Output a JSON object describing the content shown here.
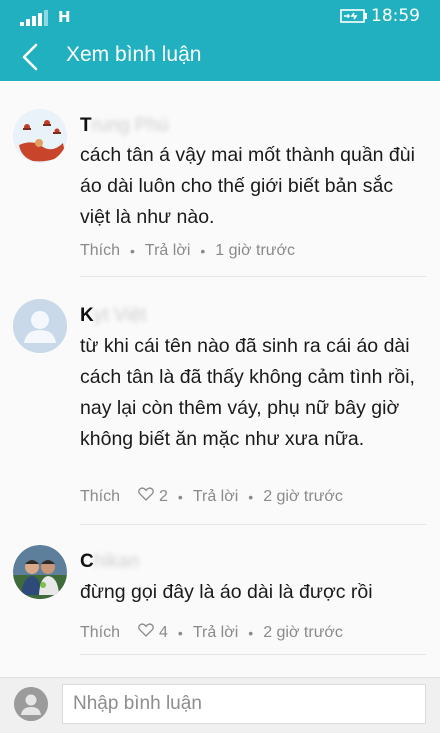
{
  "status_bar": {
    "network": "H",
    "time": "18:59"
  },
  "app_bar": {
    "title": "Xem bình luận"
  },
  "comments": [
    {
      "author_visible": "T",
      "author_obscured": "rung Phú",
      "text": "cách tân á vậy mai mốt thành quần đùi áo dài luôn cho thế giới biết bản sắc việt là như nào.",
      "like_label": "Thích",
      "likes": "",
      "reply_label": "Trả lời",
      "time": "1 giờ trước"
    },
    {
      "author_visible": "K",
      "author_obscured": "yt Việt",
      "text": "từ khi cái tên nào đã sinh ra cái áo dài cách tân là đã thấy không cảm tình rồi, nay lại còn thêm váy, phụ nữ bây giờ không biết ăn mặc như xưa nữa.",
      "like_label": "Thích",
      "likes": "2",
      "reply_label": "Trả lời",
      "time": "2 giờ trước"
    },
    {
      "author_visible": "C",
      "author_obscured": "hikan",
      "text": "đừng gọi đây là áo dài là được rồi",
      "like_label": "Thích",
      "likes": "4",
      "reply_label": "Trả lời",
      "time": "2 giờ trước"
    }
  ],
  "input": {
    "placeholder": "Nhập bình luận"
  },
  "colors": {
    "accent": "#21b0bf",
    "meta": "#8a8a8a",
    "divider": "#e4e4e4"
  },
  "icons": [
    "signal-icon",
    "battery-charging-icon",
    "back-arrow-icon",
    "heart-icon",
    "default-avatar-icon"
  ]
}
